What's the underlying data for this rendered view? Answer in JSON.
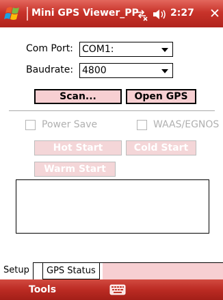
{
  "titlebar": {
    "title": "Mini GPS Viewer_PP",
    "time": "2:27",
    "close_glyph": "✕",
    "icons": [
      "windows-start-icon",
      "connectivity-icon",
      "volume-icon",
      "close-icon"
    ]
  },
  "setup": {
    "com_port_label": "Com Port:",
    "com_port_value": "COM1:",
    "baudrate_label": "Baudrate:",
    "baudrate_value": "4800",
    "scan_label": "Scan...",
    "open_gps_label": "Open GPS",
    "power_save_label": "Power Save",
    "waas_label": "WAAS/EGNOS",
    "hot_start_label": "Hot Start",
    "cold_start_label": "Cold Start",
    "warm_start_label": "Warm Start"
  },
  "tabs": [
    {
      "label": "Setup",
      "active": true
    },
    {
      "label": "GPS Status",
      "active": false
    }
  ],
  "menubar": {
    "tools_label": "Tools",
    "keyboard_icon": "keyboard-icon"
  },
  "colors": {
    "title_bar": "#c8332a",
    "button_fill": "#f7cfd2",
    "disabled_text": "#ffffff"
  }
}
